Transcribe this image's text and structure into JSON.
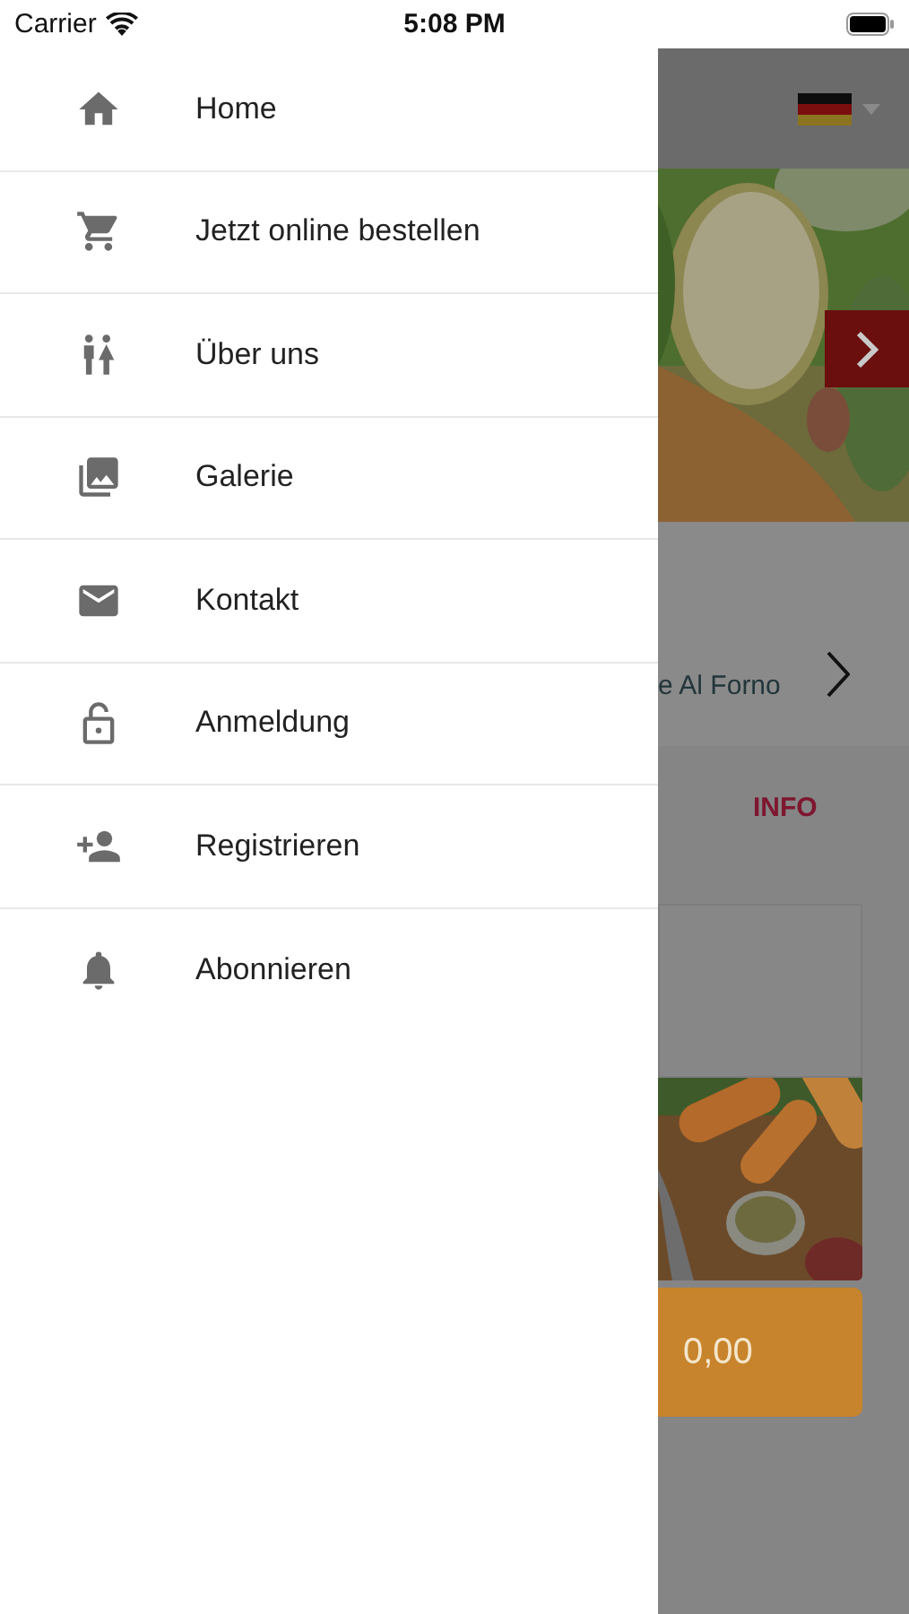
{
  "status_bar": {
    "carrier": "Carrier",
    "time": "5:08 PM"
  },
  "drawer": {
    "items": [
      {
        "label": "Home"
      },
      {
        "label": "Jetzt online bestellen"
      },
      {
        "label": "Über uns"
      },
      {
        "label": "Galerie"
      },
      {
        "label": "Kontakt"
      },
      {
        "label": "Anmeldung"
      },
      {
        "label": "Registrieren"
      },
      {
        "label": "Abonnieren"
      }
    ]
  },
  "background": {
    "restaurant_name": "e Al Forno",
    "tab": "INFO",
    "price": "0,00"
  }
}
